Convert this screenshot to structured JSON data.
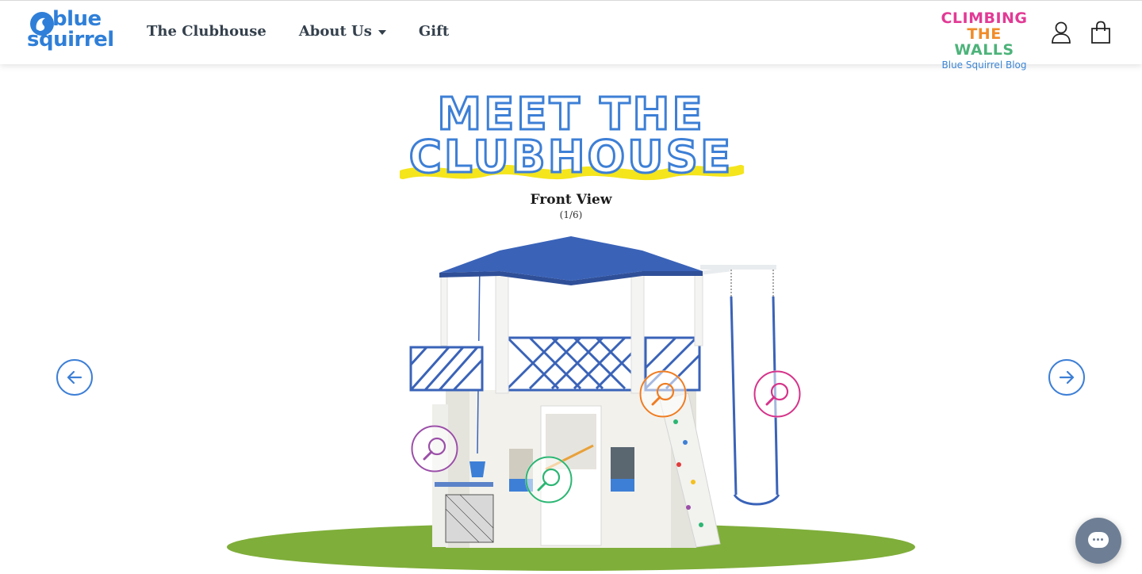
{
  "brand": {
    "logo_line1": "blue",
    "logo_line2": "squirrel"
  },
  "nav": {
    "items": [
      {
        "label": "The Clubhouse"
      },
      {
        "label": "About Us",
        "has_dropdown": true
      },
      {
        "label": "Gift"
      }
    ]
  },
  "blog": {
    "line1": "CLIMBING",
    "line2_part1": "THE",
    "line2_part2": "WALLS",
    "subtitle": "Blue Squirrel Blog"
  },
  "header_icons": [
    "account-icon",
    "shopping-bag-icon"
  ],
  "hero": {
    "title_line1": "MEET THE",
    "title_line2": "CLUBHOUSE",
    "view_label": "Front View",
    "view_counter": "(1/6)"
  },
  "carousel": {
    "prev_icon": "arrow-left-icon",
    "next_icon": "arrow-right-icon",
    "current": 1,
    "total": 6
  },
  "hotspots": [
    {
      "name": "hotspot-bucket",
      "color": "#9b4fa8"
    },
    {
      "name": "hotspot-door",
      "color": "#2bb673"
    },
    {
      "name": "hotspot-climbing-wall",
      "color": "#ef7d22"
    },
    {
      "name": "hotspot-swing",
      "color": "#d6338a"
    }
  ],
  "colors": {
    "brand_blue": "#2f7fd8",
    "title_blue": "#3d7fd6",
    "highlight_yellow": "#f4e51d",
    "grass_green": "#7fae3a",
    "roof_blue": "#3a63b8",
    "chat_button": "#6e7f95"
  },
  "chat": {
    "icon": "chat-bubble-icon"
  }
}
